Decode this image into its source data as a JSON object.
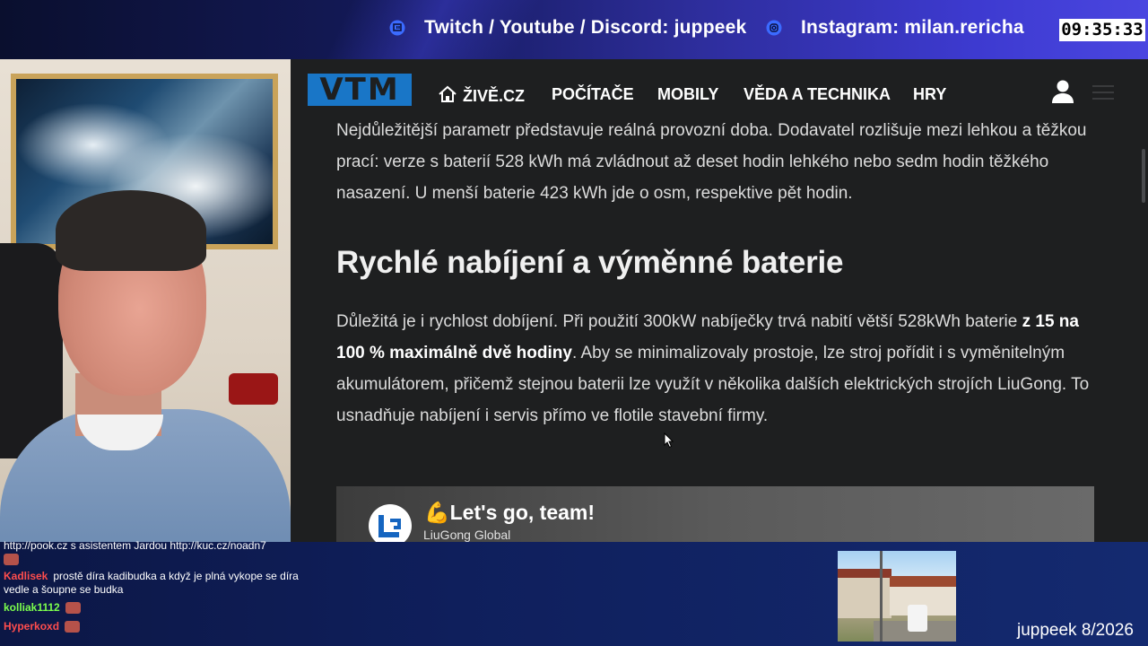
{
  "overlay": {
    "social_1": "Twitch / Youtube / Discord: juppeek",
    "social_1_icon": "twitch-icon",
    "social_2": "Instagram: milan.rericha",
    "social_2_icon": "instagram-icon",
    "clock": "09:35:33",
    "sub_goal": "juppeek 8/2026"
  },
  "site": {
    "logo": "VTM",
    "nav": [
      "ŽIVĚ.CZ",
      "POČÍTAČE",
      "MOBILY",
      "VĚDA A TECHNIKA",
      "HRY"
    ],
    "icons": [
      "home-icon",
      "user-icon",
      "menu-icon"
    ]
  },
  "article": {
    "para1": "Nejdůležitější parametr představuje reálná provozní doba. Dodavatel rozlišuje mezi lehkou a těžkou prací: verze s baterií 528 kWh má zvládnout až deset hodin lehkého nebo sedm hodin těžkého nasazení. U menší baterie 423 kWh jde o osm, respektive pět hodin.",
    "heading": "Rychlé nabíjení a výměnné baterie",
    "para2_a": "Důležitá je i rychlost dobíjení. Při použití 300kW nabíječky trvá nabití větší 528kWh baterie ",
    "para2_bold": "z 15 na 100 % maximálně dvě hodiny",
    "para2_b": ". Aby se minimalizovaly prostoje, lze stroj pořídit i s vyměnitelným akumulátorem, přičemž stejnou baterii lze využít v několika dalších elektrických strojích LiuGong. To usnadňuje nabíjení i servis přímo ve flotile stavební firmy.",
    "video_title": "💪Let's go, team!",
    "video_channel": "LiuGong Global"
  },
  "chat": [
    {
      "user": "",
      "message": "http://pook.cz s asistentem Jardou http://kuc.cz/noadn7",
      "color": "#ffffff"
    },
    {
      "user": "Kadlisek",
      "message": "prostě díra kadibudka a když je plná vykope se díra vedle a šoupne se budka",
      "color": "#ff4d4d"
    },
    {
      "user": "kolliak1112",
      "message": "",
      "color": "#7cff4d"
    },
    {
      "user": "Hyperkoxd",
      "message": "",
      "color": "#ff4d4d"
    }
  ]
}
